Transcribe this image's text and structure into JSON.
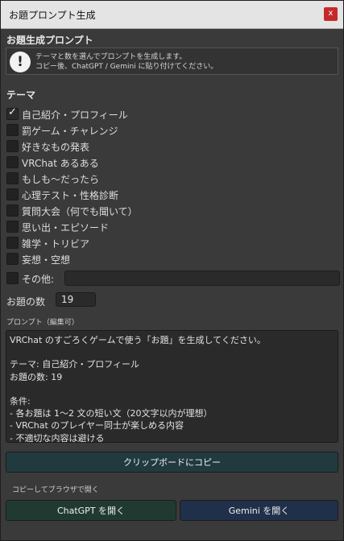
{
  "window": {
    "title": "お題プロンプト生成",
    "close_label": "x"
  },
  "header": {
    "title": "お題生成プロンプト",
    "info_icon": "exclamation-icon",
    "info_line1": "テーマと数を選んでプロンプトを生成します。",
    "info_line2": "コピー後、ChatGPT / Gemini に貼り付けてください。"
  },
  "themes": {
    "title": "テーマ",
    "items": [
      {
        "label": "自己紹介・プロフィール",
        "checked": true
      },
      {
        "label": "罰ゲーム・チャレンジ",
        "checked": false
      },
      {
        "label": "好きなもの発表",
        "checked": false
      },
      {
        "label": "VRChat あるある",
        "checked": false
      },
      {
        "label": "もしも〜だったら",
        "checked": false
      },
      {
        "label": "心理テスト・性格診断",
        "checked": false
      },
      {
        "label": "質問大会（何でも聞いて）",
        "checked": false
      },
      {
        "label": "思い出・エピソード",
        "checked": false
      },
      {
        "label": "雑学・トリビア",
        "checked": false
      },
      {
        "label": "妄想・空想",
        "checked": false
      }
    ],
    "other_label": "その他:",
    "other_value": ""
  },
  "count": {
    "label": "お題の数",
    "value": "19"
  },
  "prompt": {
    "label": "プロンプト（編集可）",
    "text": "VRChat のすごろくゲームで使う「お題」を生成してください。\n\nテーマ: 自己紹介・プロフィール\nお題の数: 19\n\n条件:\n- 各お題は 1〜2 文の短い文（20文字以内が理想）\n- VRChat のプレイヤー同士が楽しめる内容\n- 不適切な内容は避ける"
  },
  "actions": {
    "copy_label": "クリップボードにコピー",
    "copy_open_label": "コピーしてブラウザで開く",
    "chatgpt_label": "ChatGPT を開く",
    "gemini_label": "Gemini を開く"
  }
}
